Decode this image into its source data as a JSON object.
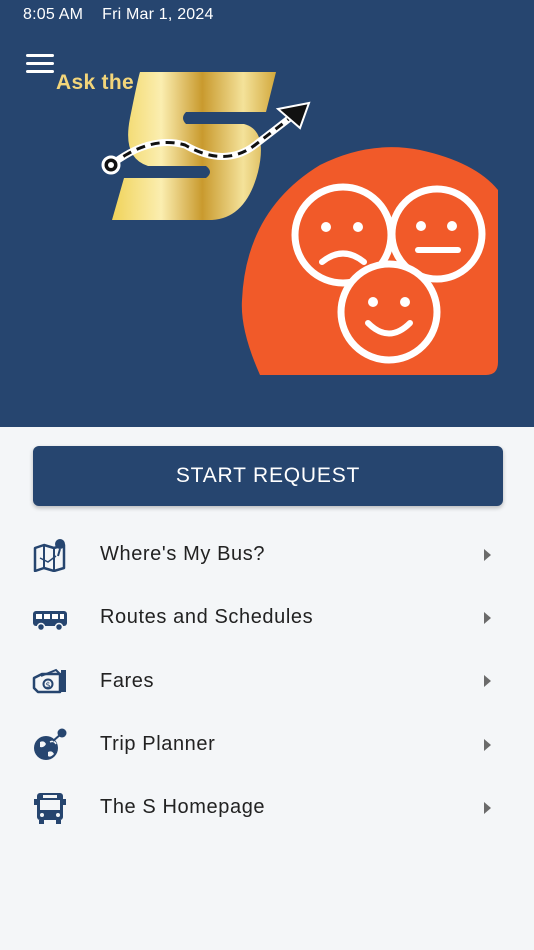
{
  "status_bar": {
    "time": "8:05 AM",
    "date": "Fri Mar 1, 2024"
  },
  "header": {
    "menu_icon": "hamburger-menu-icon",
    "brand_text": "Ask the"
  },
  "colors": {
    "hero_bg": "#26456f",
    "accent_orange": "#f15a29",
    "gold": "#d9b44a",
    "page_bg": "#f4f6f8"
  },
  "start_button": {
    "label": "START REQUEST"
  },
  "menu": {
    "items": [
      {
        "label": "Where's My Bus?",
        "icon": "map-pin-icon"
      },
      {
        "label": "Routes and Schedules",
        "icon": "bus-icon"
      },
      {
        "label": "Fares",
        "icon": "fare-cash-icon"
      },
      {
        "label": "Trip Planner",
        "icon": "globe-pin-icon"
      },
      {
        "label": "The S Homepage",
        "icon": "bus-front-icon"
      }
    ]
  }
}
